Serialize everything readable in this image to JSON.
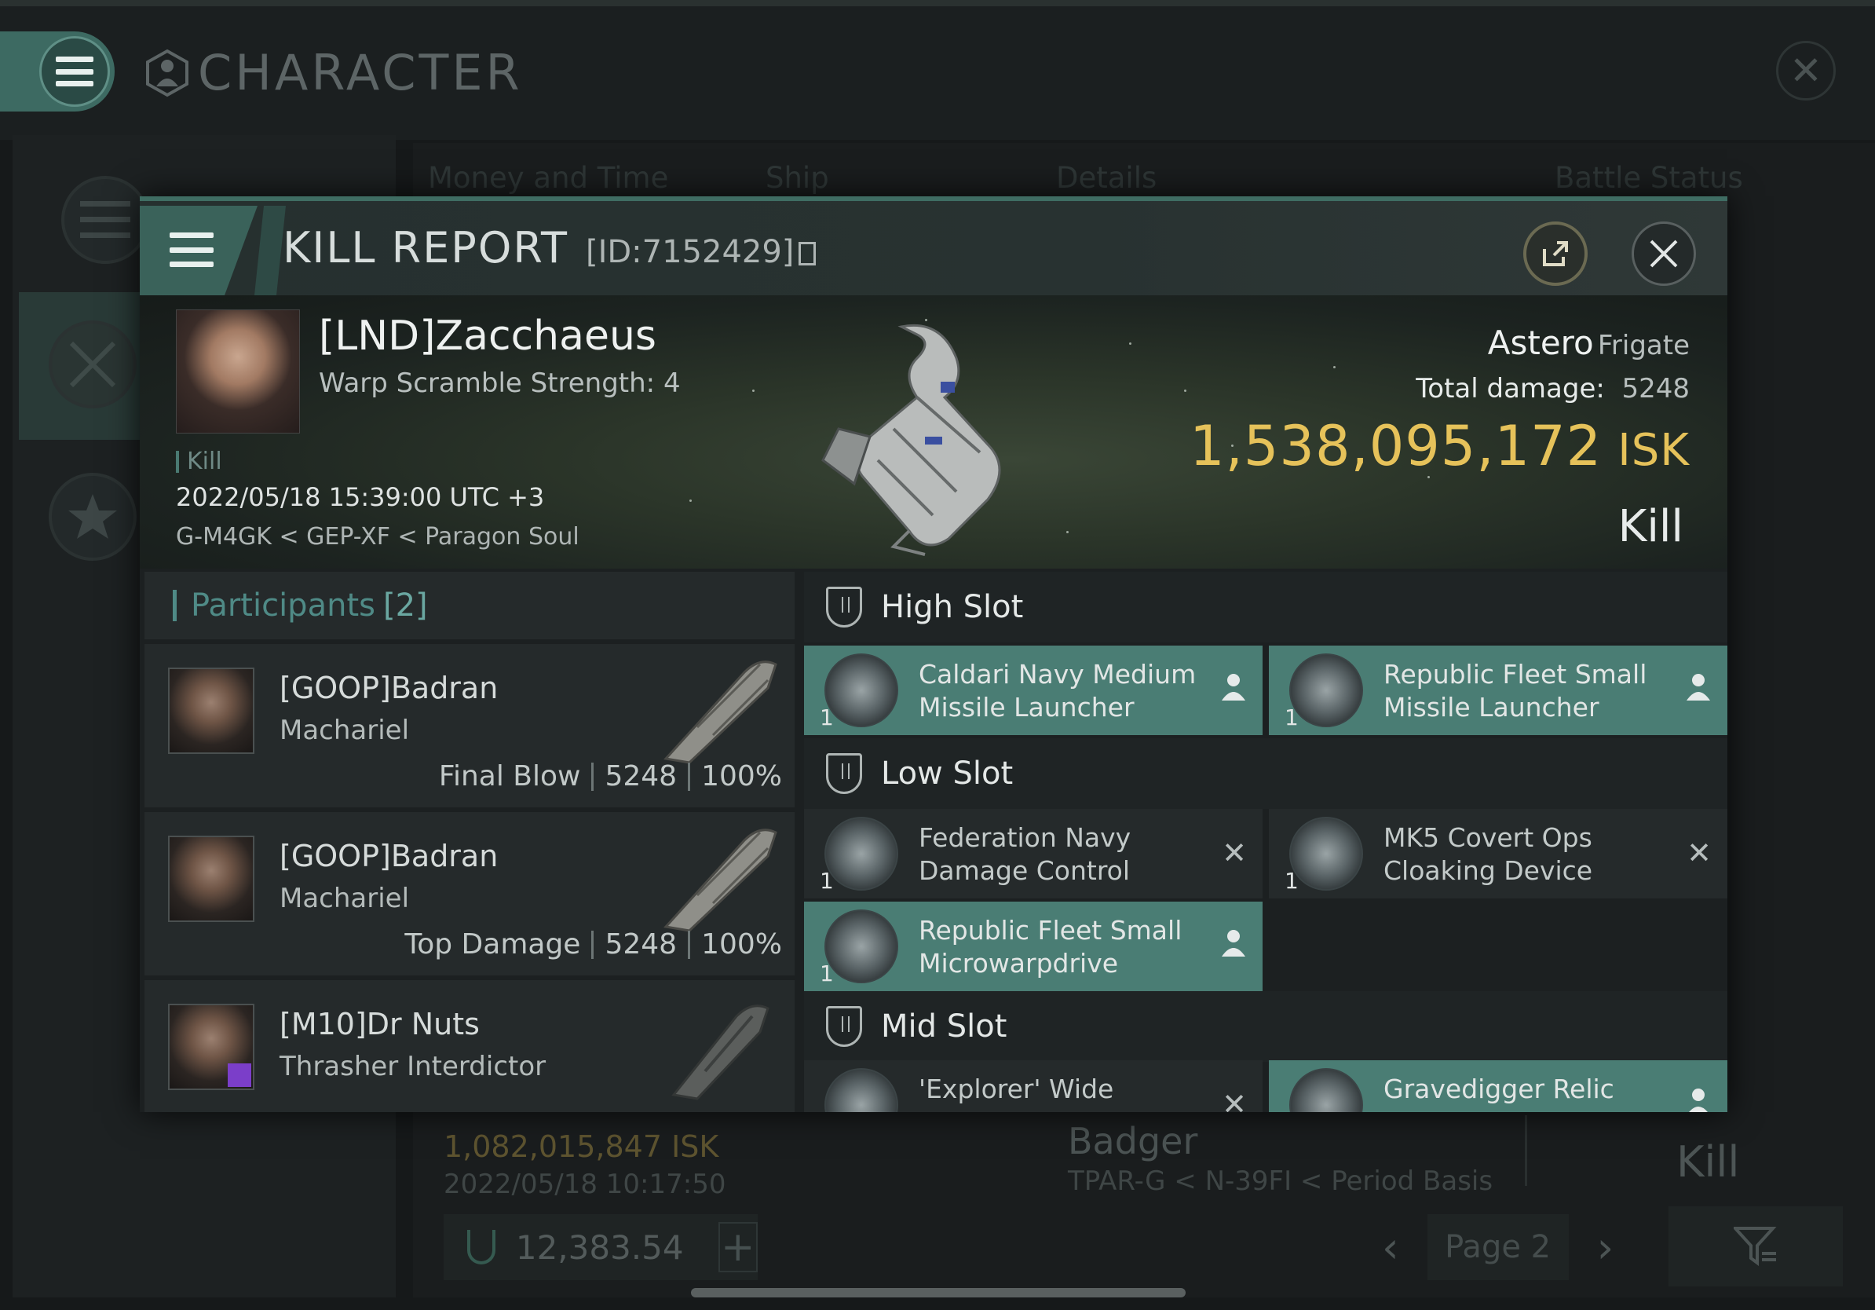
{
  "window": {
    "title": "CHARACTER",
    "tabs": [
      "Money and Time",
      "Ship",
      "Details",
      "Battle Status"
    ]
  },
  "background_row": {
    "isk": "1,082,015,847  ISK",
    "date": "2022/05/18  10:17:50",
    "ship": "Badger",
    "location": "TPAR-G < N-39FI < Period Basis",
    "result": "Kill"
  },
  "bottom_bar": {
    "wallet": "12,383.54",
    "page": "Page 2"
  },
  "kill_report": {
    "title": "KILL REPORT",
    "id": "[ID:7152429]",
    "victim": {
      "name": "[LND]Zacchaeus",
      "subtitle": "Warp Scramble Strength: 4",
      "tag": "Kill",
      "datetime": "2022/05/18 15:39:00 UTC +3",
      "location": "G-M4GK < GEP-XF < Paragon Soul"
    },
    "ship": {
      "name": "Astero",
      "class": "Frigate",
      "damage_label": "Total damage:",
      "damage": "5248",
      "value": "1,538,095,172",
      "currency": "ISK",
      "result": "Kill"
    },
    "participants": {
      "label": "Participants",
      "count": "[2]",
      "rows": [
        {
          "name": "[GOOP]Badran",
          "ship": "Machariel",
          "role": "Final Blow",
          "damage": "5248",
          "percent": "100%"
        },
        {
          "name": "[GOOP]Badran",
          "ship": "Machariel",
          "role": "Top Damage",
          "damage": "5248",
          "percent": "100%"
        },
        {
          "name": "[M10]Dr Nuts",
          "ship": "Thrasher Interdictor",
          "role": "",
          "damage": "",
          "percent": ""
        }
      ]
    },
    "slots": {
      "high": {
        "label": "High Slot",
        "modules": [
          {
            "qty": "1",
            "name": "Caldari Navy Medium Missile Launcher",
            "state": "fitted"
          },
          {
            "qty": "1",
            "name": "Republic Fleet Small Missile Launcher",
            "state": "fitted"
          }
        ]
      },
      "low": {
        "label": "Low Slot",
        "modules": [
          {
            "qty": "1",
            "name": "Federation Navy Damage Control",
            "state": "destroyed"
          },
          {
            "qty": "1",
            "name": "MK5 Covert Ops Cloaking Device",
            "state": "destroyed"
          },
          {
            "qty": "1",
            "name": "Republic Fleet Small Microwarpdrive",
            "state": "fitted"
          }
        ]
      },
      "mid": {
        "label": "Mid Slot",
        "modules": [
          {
            "qty": "",
            "name": "'Explorer' Wide",
            "state": "destroyed"
          },
          {
            "qty": "",
            "name": "Gravedigger Relic",
            "state": "fitted"
          }
        ]
      }
    }
  },
  "icons": {
    "fitted": "person-icon",
    "destroyed": "close-x-icon"
  },
  "colors": {
    "accent": "#4a7d74",
    "isk": "#e6c25a"
  }
}
